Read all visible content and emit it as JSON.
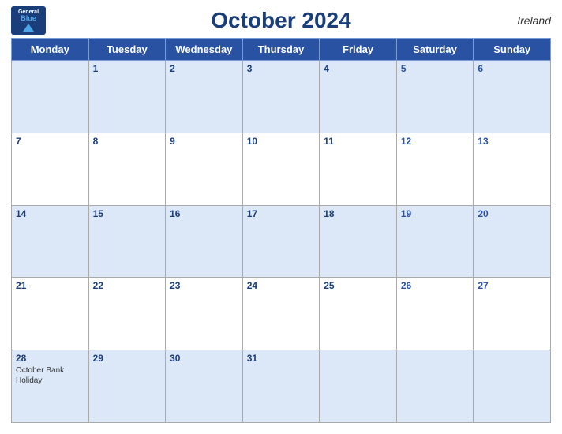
{
  "header": {
    "logo": {
      "line1": "General",
      "line2": "Blue"
    },
    "title": "October 2024",
    "country": "Ireland"
  },
  "days_of_week": [
    "Monday",
    "Tuesday",
    "Wednesday",
    "Thursday",
    "Friday",
    "Saturday",
    "Sunday"
  ],
  "weeks": [
    {
      "shade": "blue",
      "days": [
        {
          "num": "",
          "holiday": ""
        },
        {
          "num": "1",
          "holiday": ""
        },
        {
          "num": "2",
          "holiday": ""
        },
        {
          "num": "3",
          "holiday": ""
        },
        {
          "num": "4",
          "holiday": ""
        },
        {
          "num": "5",
          "holiday": ""
        },
        {
          "num": "6",
          "holiday": ""
        }
      ]
    },
    {
      "shade": "white",
      "days": [
        {
          "num": "7",
          "holiday": ""
        },
        {
          "num": "8",
          "holiday": ""
        },
        {
          "num": "9",
          "holiday": ""
        },
        {
          "num": "10",
          "holiday": ""
        },
        {
          "num": "11",
          "holiday": ""
        },
        {
          "num": "12",
          "holiday": ""
        },
        {
          "num": "13",
          "holiday": ""
        }
      ]
    },
    {
      "shade": "blue",
      "days": [
        {
          "num": "14",
          "holiday": ""
        },
        {
          "num": "15",
          "holiday": ""
        },
        {
          "num": "16",
          "holiday": ""
        },
        {
          "num": "17",
          "holiday": ""
        },
        {
          "num": "18",
          "holiday": ""
        },
        {
          "num": "19",
          "holiday": ""
        },
        {
          "num": "20",
          "holiday": ""
        }
      ]
    },
    {
      "shade": "white",
      "days": [
        {
          "num": "21",
          "holiday": ""
        },
        {
          "num": "22",
          "holiday": ""
        },
        {
          "num": "23",
          "holiday": ""
        },
        {
          "num": "24",
          "holiday": ""
        },
        {
          "num": "25",
          "holiday": ""
        },
        {
          "num": "26",
          "holiday": ""
        },
        {
          "num": "27",
          "holiday": ""
        }
      ]
    },
    {
      "shade": "blue",
      "days": [
        {
          "num": "28",
          "holiday": "October Bank Holiday"
        },
        {
          "num": "29",
          "holiday": ""
        },
        {
          "num": "30",
          "holiday": ""
        },
        {
          "num": "31",
          "holiday": ""
        },
        {
          "num": "",
          "holiday": ""
        },
        {
          "num": "",
          "holiday": ""
        },
        {
          "num": "",
          "holiday": ""
        }
      ]
    }
  ]
}
